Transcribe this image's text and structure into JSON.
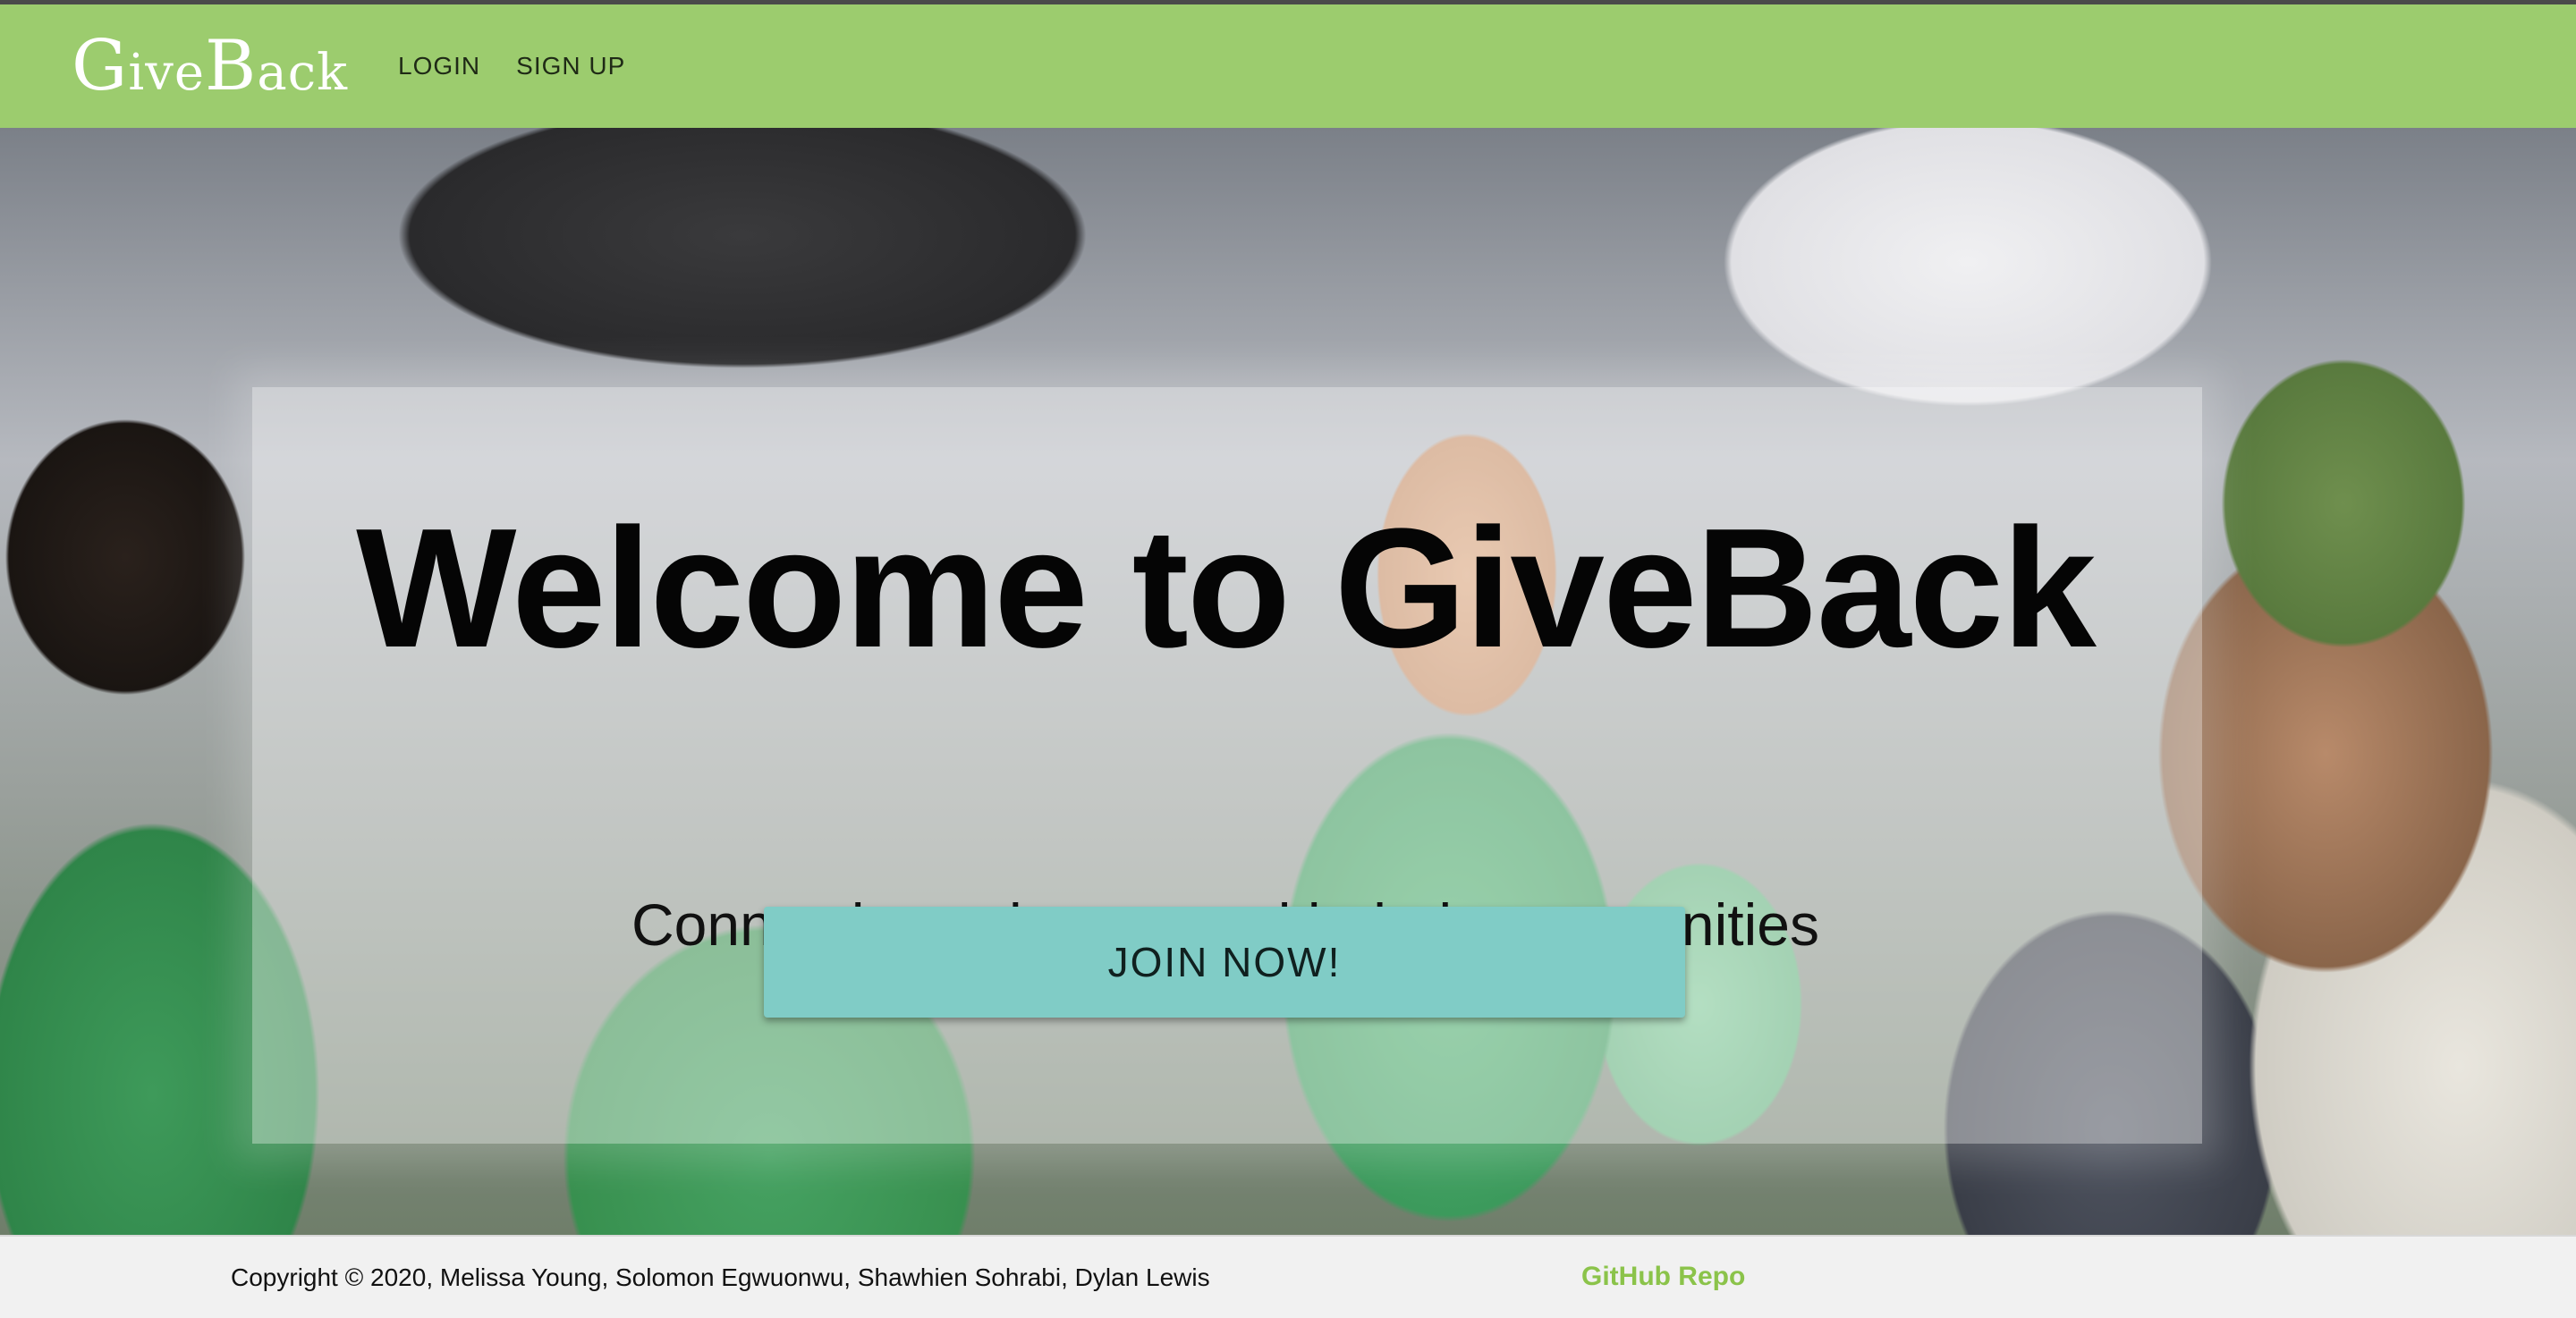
{
  "navbar": {
    "brand": {
      "first_cap": "G",
      "first_rest": "ive",
      "second_cap": "B",
      "second_rest": "ack"
    },
    "links": [
      {
        "label": "LOGIN"
      },
      {
        "label": "SIGN UP"
      }
    ]
  },
  "hero": {
    "title": "Welcome to GiveBack",
    "subtitle": "Connecting volunteers with their communities",
    "cta_label": "JOIN NOW!",
    "background_image": "volunteers-photo"
  },
  "footer": {
    "copyright": "Copyright © 2020, Melissa Young, Solomon Egwuonwu, Shawhien Sohrabi, Dylan Lewis",
    "repo_link": "GitHub Repo"
  },
  "colors": {
    "navbar_bg": "#9ccc6e",
    "button_bg": "#80ccc6",
    "repo_link": "#8bc34a"
  }
}
